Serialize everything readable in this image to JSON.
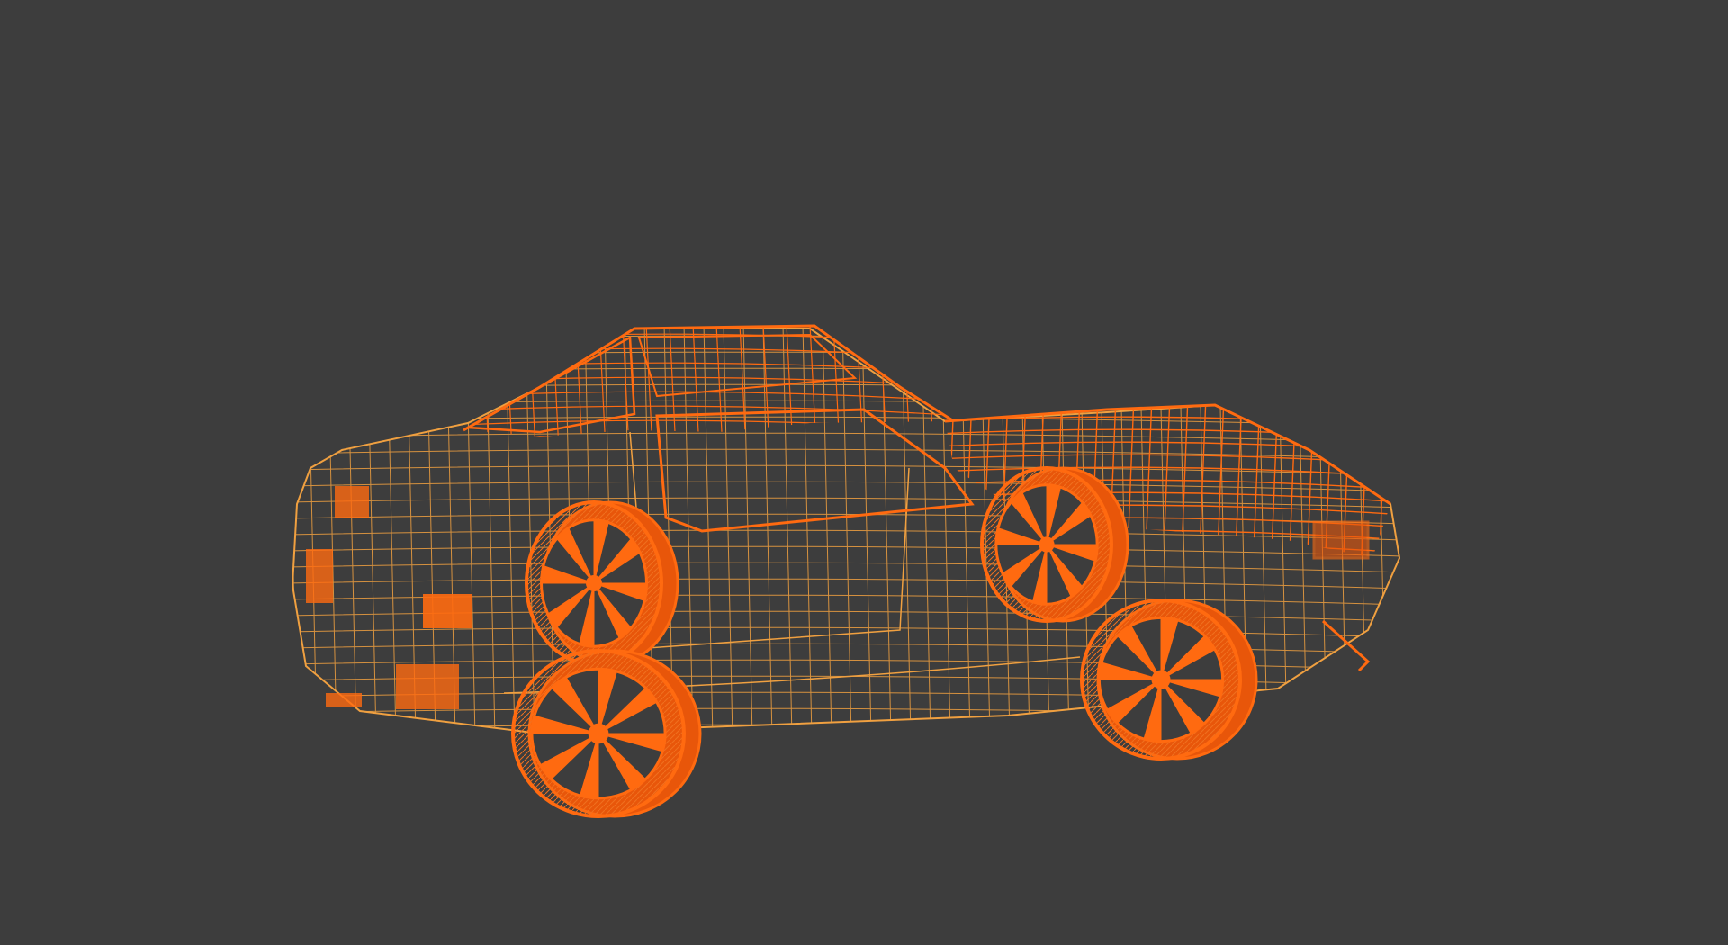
{
  "viewport": {
    "background": "#3d3d3d",
    "display_mode": "wireframe",
    "selection": "car-model"
  },
  "model": {
    "kind": "sports-car",
    "wire_color": "#f0a040",
    "selected_color": "#ff6a10",
    "dense_color": "#e8560a"
  }
}
